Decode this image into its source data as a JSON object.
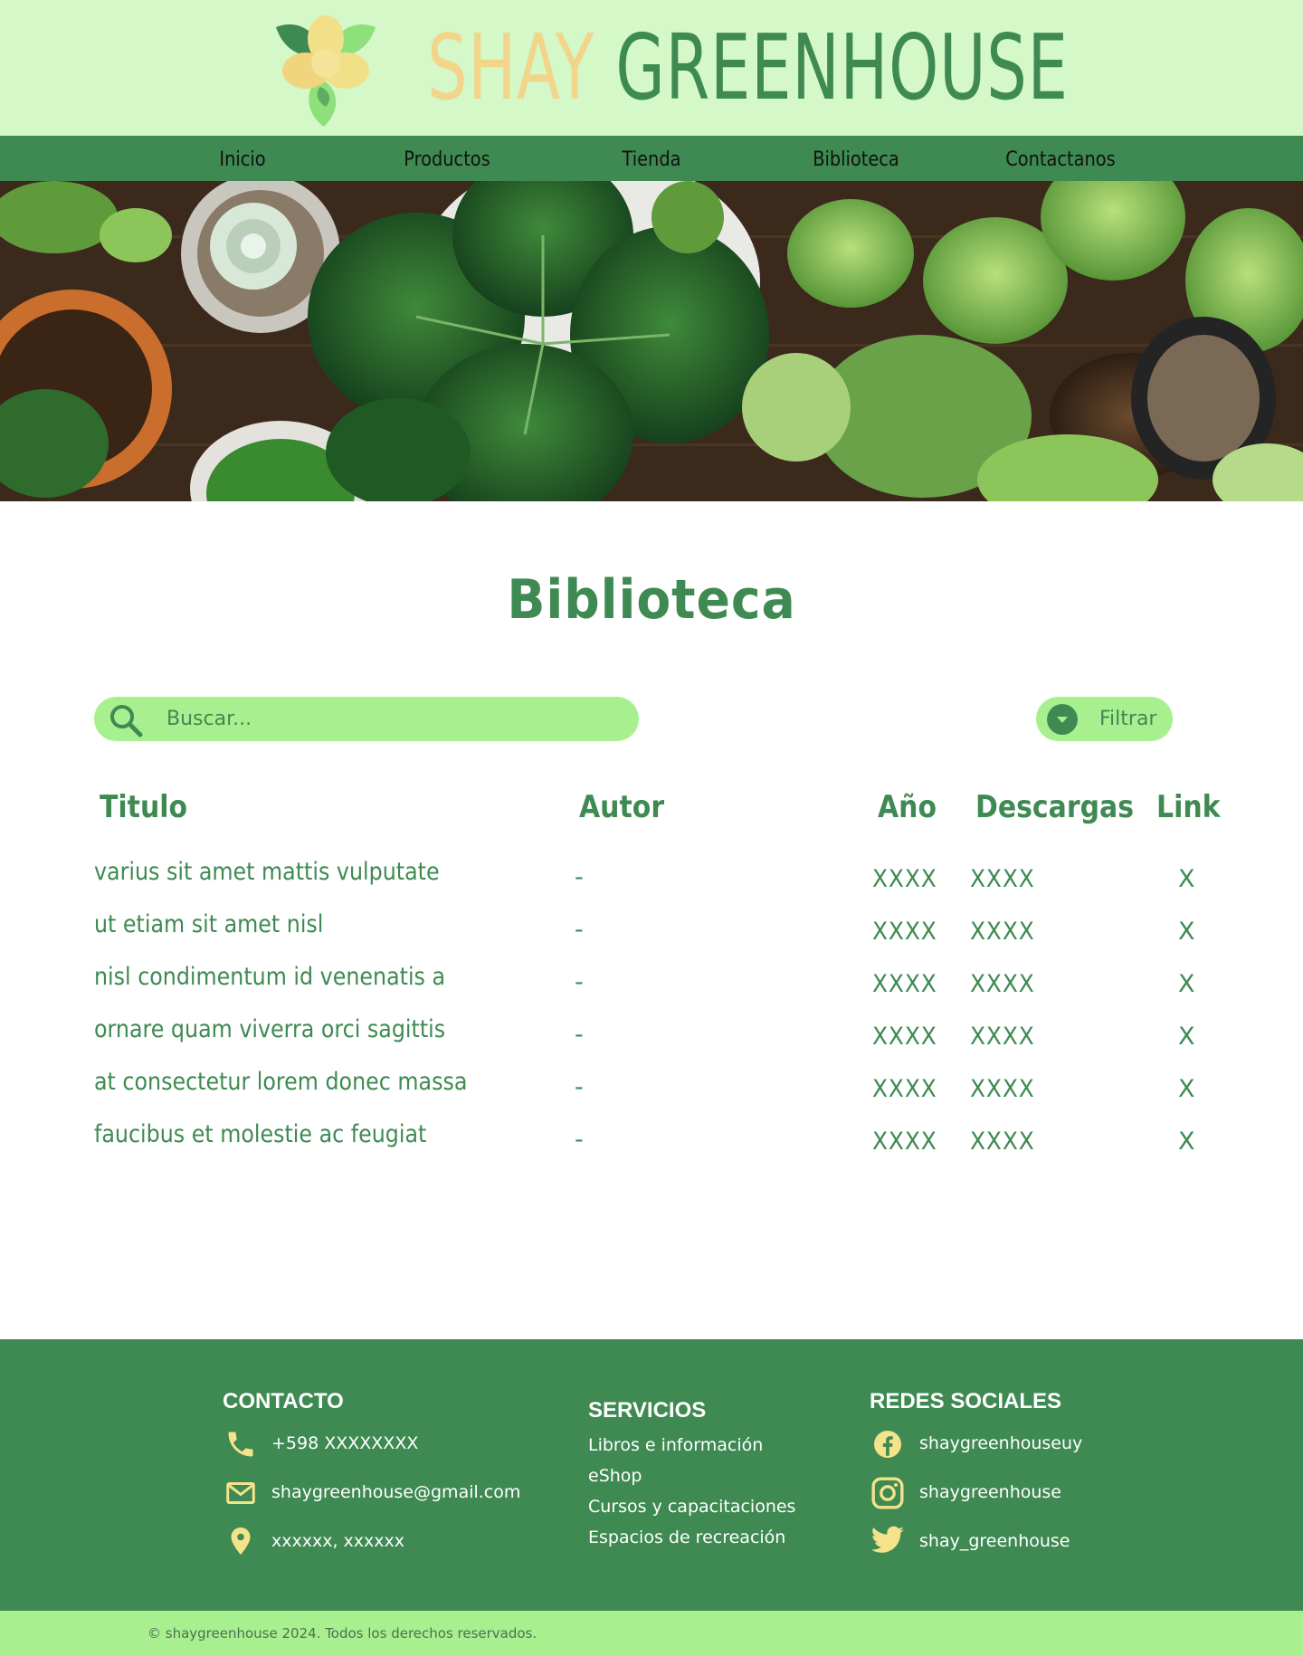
{
  "brand": {
    "word1": "SHAY",
    "word2": "GREENHOUSE"
  },
  "nav": {
    "items": [
      "Inicio",
      "Productos",
      "Tienda",
      "Biblioteca",
      "Contactanos"
    ]
  },
  "page": {
    "title": "Biblioteca"
  },
  "search": {
    "placeholder": "Buscar..."
  },
  "filter": {
    "label": "Filtrar"
  },
  "table": {
    "headers": {
      "title": "Titulo",
      "author": "Autor",
      "year": "Año",
      "downloads": "Descargas",
      "link": "Link"
    },
    "rows": [
      {
        "title": "varius sit amet mattis vulputate",
        "author": "-",
        "year": "XXXX",
        "downloads": "XXXX",
        "link": "X"
      },
      {
        "title": "ut etiam sit amet nisl",
        "author": "-",
        "year": "XXXX",
        "downloads": "XXXX",
        "link": "X"
      },
      {
        "title": "nisl condimentum id venenatis a",
        "author": "-",
        "year": "XXXX",
        "downloads": "XXXX",
        "link": "X"
      },
      {
        "title": "ornare quam viverra orci sagittis",
        "author": "-",
        "year": "XXXX",
        "downloads": "XXXX",
        "link": "X"
      },
      {
        "title": "at consectetur lorem donec massa",
        "author": "-",
        "year": "XXXX",
        "downloads": "XXXX",
        "link": "X"
      },
      {
        "title": "faucibus et molestie ac feugiat",
        "author": "-",
        "year": "XXXX",
        "downloads": "XXXX",
        "link": "X"
      }
    ]
  },
  "footer": {
    "contact": {
      "heading": "CONTACTO",
      "phone": "+598 XXXXXXXX",
      "email": "shaygreenhouse@gmail.com",
      "address": "xxxxxx, xxxxxx"
    },
    "services": {
      "heading": "SERVICIOS",
      "items": [
        "Libros e información",
        "eShop",
        "Cursos y capacitaciones",
        "Espacios de recreación"
      ]
    },
    "social": {
      "heading": "REDES SOCIALES",
      "facebook": "shaygreenhouseuy",
      "instagram": "shaygreenhouse",
      "twitter": "shay_greenhouse"
    },
    "copyright": "© shaygreenhouse 2024. Todos los derechos reservados."
  },
  "colors": {
    "header_bg": "#d4f8c8",
    "primary_green": "#3e8a52",
    "light_green": "#a8f08f",
    "brand_yellow": "#f2d58a",
    "icon_yellow": "#f5e38c"
  },
  "icons": {
    "logo": "flower-logo-icon",
    "search": "search-icon",
    "filter": "chevron-down-icon",
    "phone": "phone-icon",
    "email": "mail-icon",
    "address": "location-pin-icon",
    "facebook": "facebook-icon",
    "instagram": "instagram-icon",
    "twitter": "twitter-icon"
  }
}
